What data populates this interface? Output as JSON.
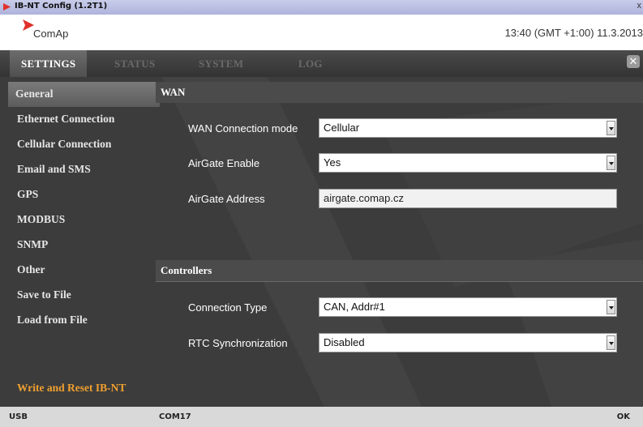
{
  "window": {
    "title": "IB-NT Config (1.2T1)",
    "close_glyph": "x"
  },
  "header": {
    "brand": "ComAp",
    "datetime": "13:40 (GMT +1:00) 11.3.2013"
  },
  "tabs": [
    {
      "label": "SETTINGS",
      "active": true
    },
    {
      "label": "STATUS",
      "active": false
    },
    {
      "label": "SYSTEM",
      "active": false
    },
    {
      "label": "LOG",
      "active": false
    }
  ],
  "sidebar": {
    "items": [
      {
        "label": "General"
      },
      {
        "label": "Ethernet Connection"
      },
      {
        "label": "Cellular Connection"
      },
      {
        "label": "Email and SMS"
      },
      {
        "label": "GPS"
      },
      {
        "label": "MODBUS"
      },
      {
        "label": "SNMP"
      },
      {
        "label": "Other"
      },
      {
        "label": "Save to File"
      },
      {
        "label": "Load from File"
      }
    ],
    "action": "Write and Reset IB-NT"
  },
  "wan": {
    "title": "WAN",
    "mode_label": "WAN Connection mode",
    "mode_value": "Cellular",
    "airgate_enable_label": "AirGate Enable",
    "airgate_enable_value": "Yes",
    "airgate_address_label": "AirGate Address",
    "airgate_address_value": "airgate.comap.cz"
  },
  "controllers": {
    "title": "Controllers",
    "conn_type_label": "Connection Type",
    "conn_type_value": "CAN, Addr#1",
    "rtc_label": "RTC Synchronization",
    "rtc_value": "Disabled"
  },
  "status": {
    "left": "USB",
    "port": "COM17",
    "right": "OK"
  },
  "colors": {
    "accent": "#f0a030",
    "content_bg": "#3c3c3c",
    "brand_red": "#e0302a"
  }
}
